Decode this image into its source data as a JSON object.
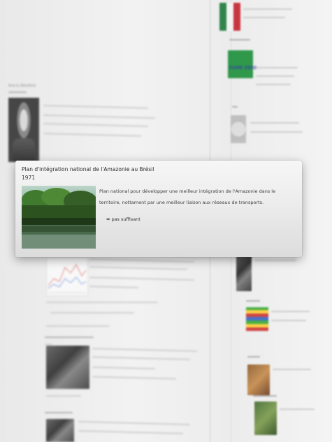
{
  "popup": {
    "title": "Plan d'intégration national de l'Amazonie au Brésil",
    "year": "1971",
    "description": "Plan national pour développer une meilleur intégration de l'Amazonie dans le territoire, nottament par une meilleur liaison aux réseaux de transports.",
    "link_icon": "arrow-right-icon",
    "link_label": "pas suffisant"
  },
  "background": {
    "left_top_label": "Ana & Albufeira",
    "logo_text": "FOME ZERO",
    "colors": {
      "popup_bg": "#ececec",
      "text": "#3e3e3e"
    }
  }
}
